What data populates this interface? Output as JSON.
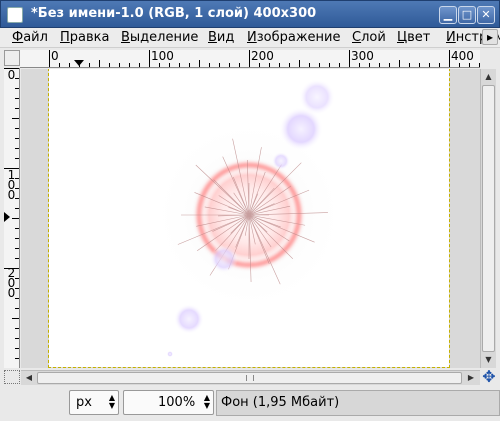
{
  "window": {
    "title": "*Без имени-1.0 (RGB, 1 слой) 400x300",
    "minimize_label": "▁",
    "maximize_label": "□",
    "close_label": "✕"
  },
  "menu": {
    "items": [
      "Файл",
      "Правка",
      "Выделение",
      "Вид",
      "Изображение",
      "Слой",
      "Цвет",
      "Инструм"
    ],
    "overflow_label": "▸"
  },
  "rulers": {
    "horizontal_labels": [
      "0",
      "100",
      "200",
      "300",
      "400"
    ],
    "vertical_labels": [
      "0",
      "100",
      "200"
    ]
  },
  "statusbar": {
    "unit": "px",
    "zoom": "100%",
    "spin_glyph": "▲\n▼",
    "info": "Фон (1,95 Мбайт)"
  },
  "canvas": {
    "background": "#ffffff",
    "flare_color": "#ff5a5a",
    "ghost_color": "#c9b2ff",
    "selection_border": "#c4b000"
  }
}
